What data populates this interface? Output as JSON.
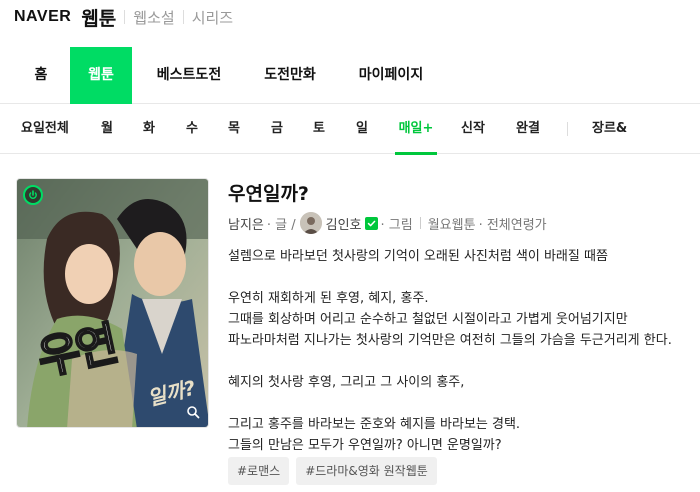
{
  "brand": {
    "naver": "NAVER",
    "webtoon": "웹툰",
    "links": [
      "웹소설",
      "시리즈"
    ]
  },
  "main_nav": {
    "items": [
      "홈",
      "웹툰",
      "베스트도전",
      "도전만화",
      "마이페이지"
    ],
    "active": "웹툰"
  },
  "sub_nav": {
    "items": [
      "요일전체",
      "월",
      "화",
      "수",
      "목",
      "금",
      "토",
      "일",
      "매일+",
      "신작",
      "완결",
      "장르&"
    ],
    "active": "매일+"
  },
  "work": {
    "title": "우연일까?",
    "writer": "남지은",
    "writer_role": "· 글 /",
    "artist": "김인호",
    "artist_role": "· 그림",
    "schedule": "월요웹툰",
    "age": "· 전체연령가",
    "description": [
      "설렘으로 바라보던 첫사랑의 기억이 오래된 사진처럼 색이 바래질 때쯤",
      "",
      "우연히 재회하게 된 후영, 혜지, 홍주.",
      "그때를 회상하며 어리고 순수하고 철없던 시절이라고 가볍게 웃어넘기지만",
      "파노라마처럼 지나가는 첫사랑의 기억만은 여전히 그들의 가슴을 두근거리게 한다.",
      "",
      "혜지의 첫사랑 후영, 그리고 그 사이의 홍주,",
      "",
      "그리고 홍주를 바라보는 준호와 혜지를 바라보는 경택.",
      "그들의 만남은 모두가 우연일까? 아니면 운명일까?"
    ],
    "tags": [
      "#로맨스",
      "#드라마&영화 원작웹툰"
    ],
    "cover_title": "우연",
    "cover_subtitle": "일까?"
  },
  "colors": {
    "accent": "#00dc64",
    "accent_text": "#00c73c"
  }
}
